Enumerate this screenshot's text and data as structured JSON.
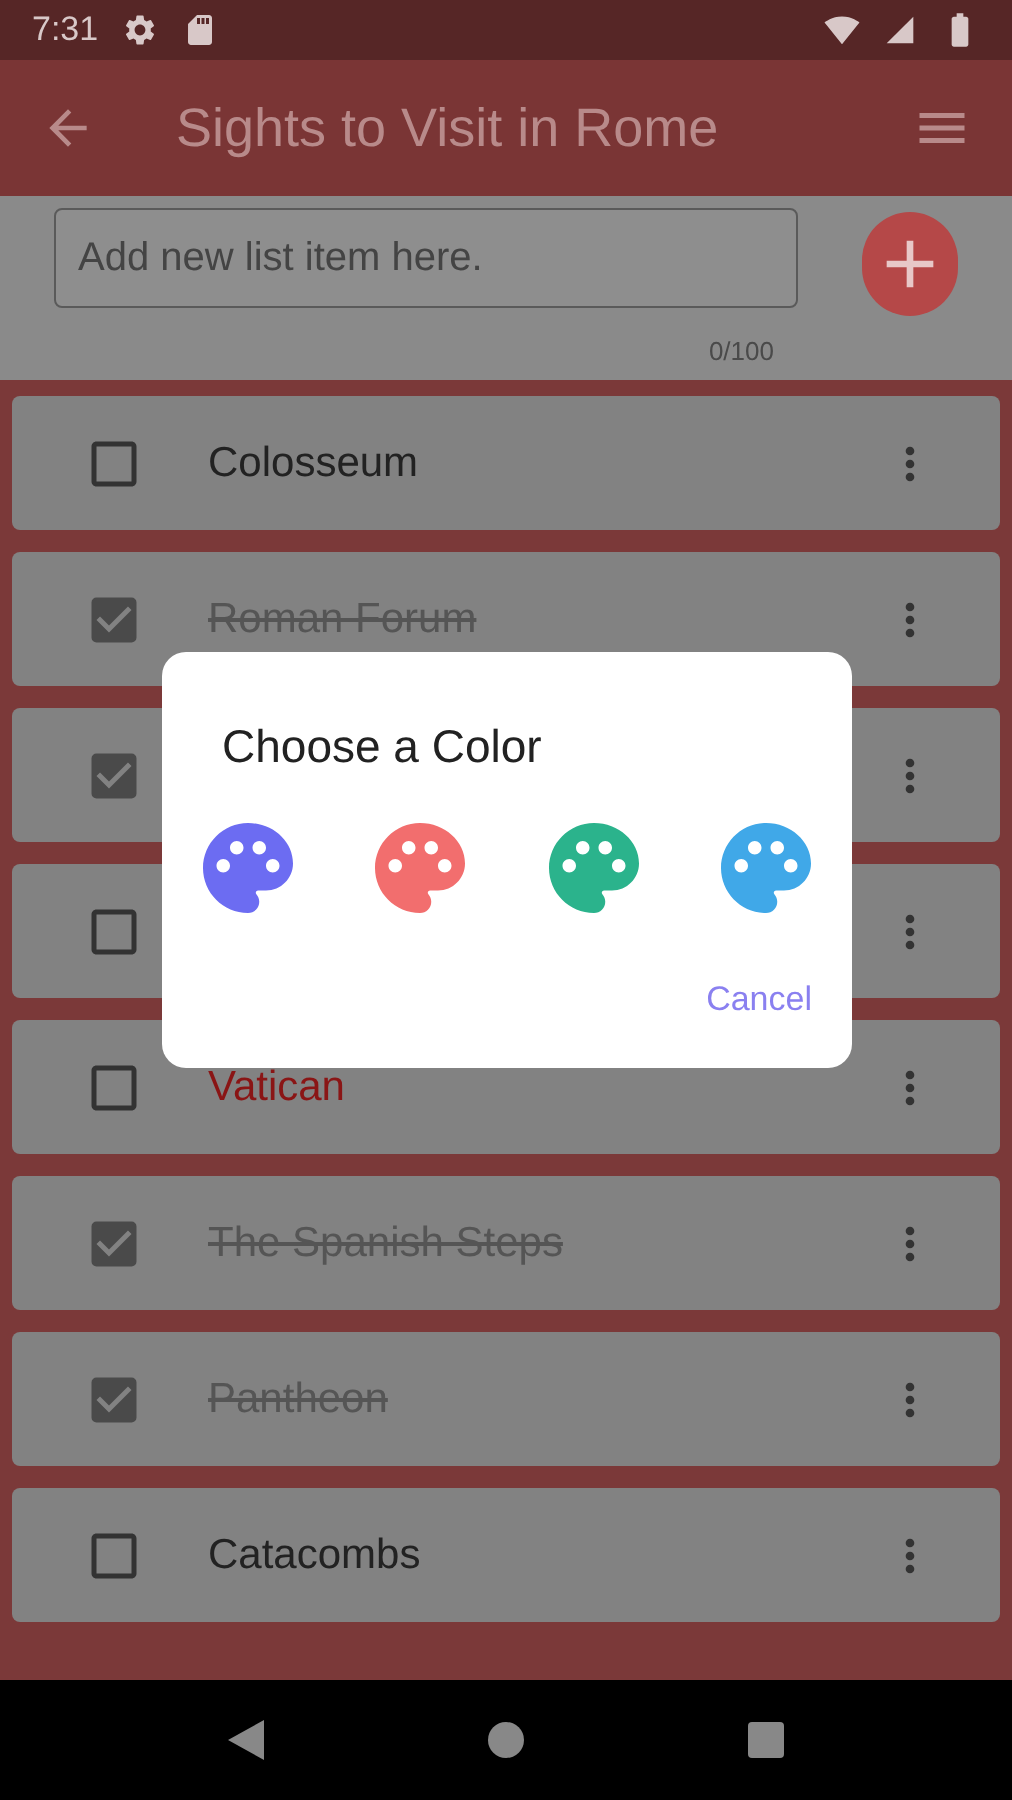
{
  "status_bar": {
    "time": "7:31"
  },
  "app_bar": {
    "title": "Sights to Visit in Rome"
  },
  "new_item": {
    "placeholder": "Add new list item here.",
    "counter": "0/100"
  },
  "items": [
    {
      "text": "Colosseum",
      "checked": false
    },
    {
      "text": "Roman Forum",
      "checked": true
    },
    {
      "checked": true
    },
    {
      "checked": false
    },
    {
      "text": "Vatican",
      "checked": false,
      "color": "#8a1515"
    },
    {
      "text": "The Spanish Steps",
      "checked": true
    },
    {
      "text": "Pantheon",
      "checked": true
    },
    {
      "text": "Catacombs",
      "checked": false
    }
  ],
  "dialog": {
    "title": "Choose a Color",
    "palettes": [
      {
        "color": "#6c6cf2"
      },
      {
        "color": "#f26e6e"
      },
      {
        "color": "#2bb38c"
      },
      {
        "color": "#40a8e8"
      }
    ],
    "cancel": "Cancel"
  }
}
